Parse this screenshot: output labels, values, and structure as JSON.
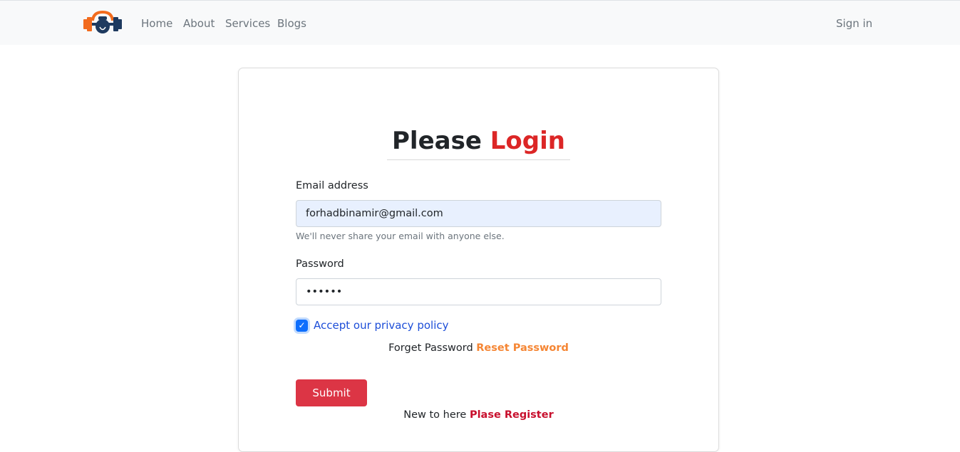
{
  "nav": {
    "brand_icon": "dumbbell-kettlebell-logo",
    "links": [
      "Home",
      "About",
      "Services",
      "Blogs"
    ],
    "signin": "Sign in"
  },
  "form": {
    "title_black": "Please",
    "title_red": "Login",
    "email_label": "Email address",
    "email_value": "forhadbinamir@gmail.com",
    "email_help": "We'll never share your email with anyone else.",
    "password_label": "Password",
    "password_value": "••••••",
    "checkbox_checked": true,
    "checkbox_label": "Accept our privacy policy",
    "forget_text": "Forget Password",
    "reset_link": "Reset Password",
    "submit_label": "Submit",
    "new_text": "New to here",
    "register_link": "Plase Register"
  },
  "colors": {
    "accent_red": "#dc3545",
    "link_orange": "#f58634",
    "link_blue": "#1d4ed8",
    "navbar_bg": "#f8f9fa"
  }
}
